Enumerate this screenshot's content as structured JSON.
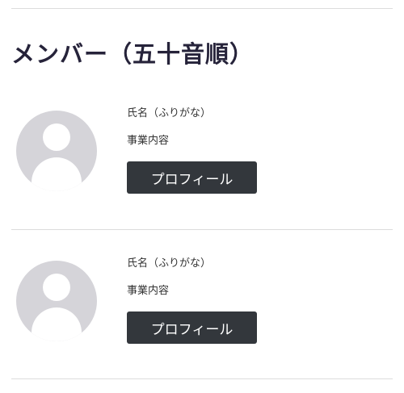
{
  "page": {
    "title": "メンバー（五十音順）"
  },
  "members": [
    {
      "name": "氏名（ふりがな）",
      "business": "事業内容",
      "button_label": "プロフィール",
      "avatar_icon": "user-placeholder-icon"
    },
    {
      "name": "氏名（ふりがな）",
      "business": "事業内容",
      "button_label": "プロフィール",
      "avatar_icon": "user-placeholder-icon"
    }
  ],
  "colors": {
    "title": "#26233a",
    "button_bg": "#33373c",
    "avatar_bg": "#d5d4d9",
    "divider": "#dcdcdc"
  }
}
